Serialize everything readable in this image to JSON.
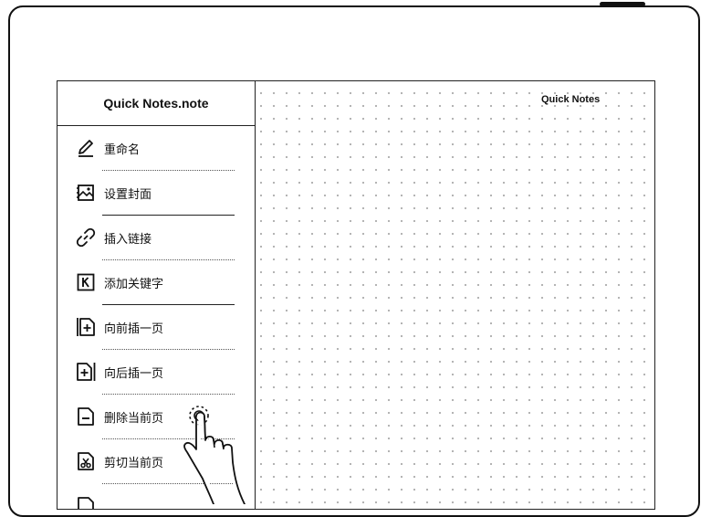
{
  "note": {
    "sidebar_title": "Quick Notes.note",
    "page_title": "Quick Notes"
  },
  "menu": {
    "items": [
      {
        "label": "重命名",
        "icon": "pencil-icon"
      },
      {
        "label": "设置封面",
        "icon": "cover-image-icon"
      },
      {
        "label": "插入链接",
        "icon": "link-icon"
      },
      {
        "label": "添加关键字",
        "icon": "keyword-k-icon"
      },
      {
        "label": "向前插一页",
        "icon": "insert-page-before-icon"
      },
      {
        "label": "向后插一页",
        "icon": "insert-page-after-icon"
      },
      {
        "label": "删除当前页",
        "icon": "delete-page-icon"
      },
      {
        "label": "剪切当前页",
        "icon": "cut-page-icon"
      }
    ]
  },
  "gesture": {
    "icon": "tap-hand-icon",
    "target": "删除当前页"
  }
}
